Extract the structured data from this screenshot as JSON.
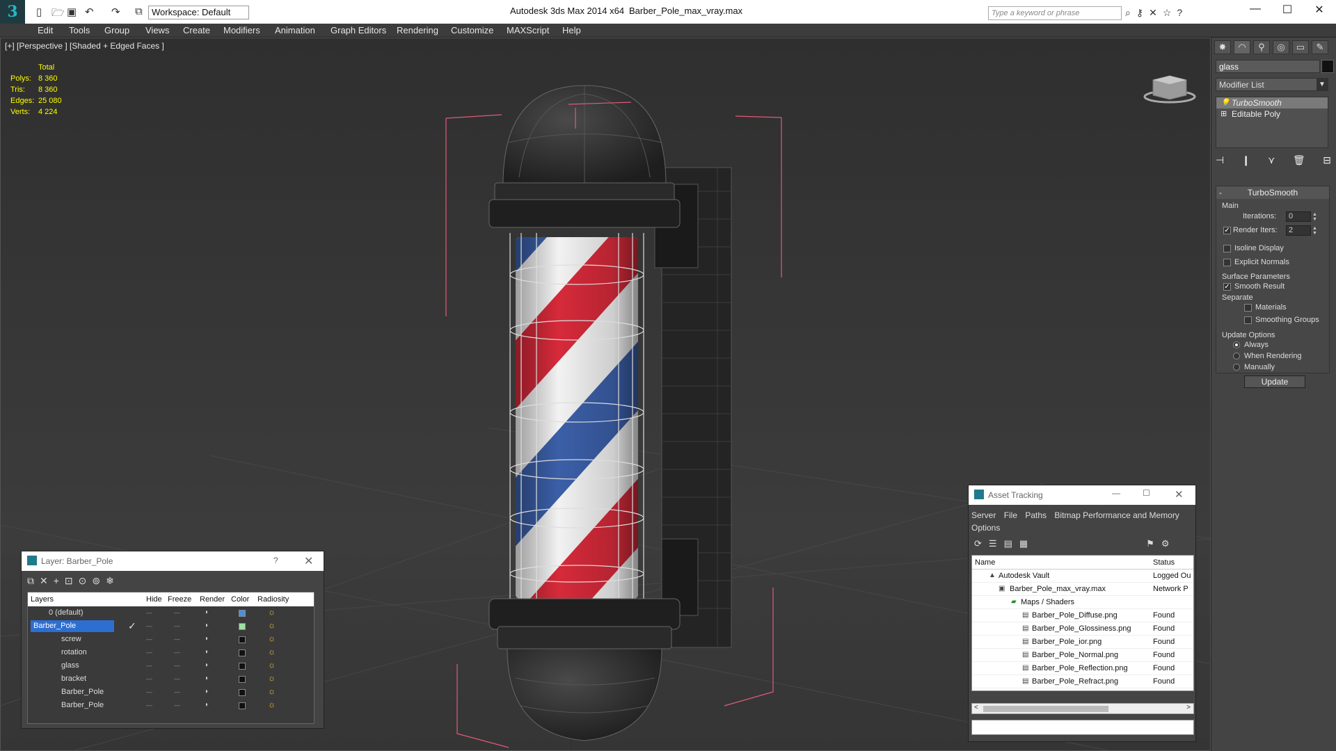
{
  "titlebar": {
    "app_title": "Autodesk 3ds Max  2014 x64",
    "file_name": "Barber_Pole_max_vray.max",
    "workspace": "Workspace: Default",
    "search_placeholder": "Type a keyword or phrase"
  },
  "menu": [
    "Edit",
    "Tools",
    "Group",
    "Views",
    "Create",
    "Modifiers",
    "Animation",
    "Graph Editors",
    "Rendering",
    "Customize",
    "MAXScript",
    "Help"
  ],
  "viewport": {
    "label": "[+] [Perspective ] [Shaded + Edged Faces ]",
    "stats": {
      "header": "Total",
      "rows": [
        {
          "k": "Polys:",
          "v": "8 360"
        },
        {
          "k": "Tris:",
          "v": "8 360"
        },
        {
          "k": "Edges:",
          "v": "25 080"
        },
        {
          "k": "Verts:",
          "v": "4 224"
        }
      ]
    },
    "stripe_colors": {
      "red": "#d62a3a",
      "blue": "#3b5fa8",
      "white": "#f2f2f2"
    }
  },
  "command_panel": {
    "object_name": "glass",
    "modifier_list": "Modifier List",
    "stack": [
      "TurboSmooth",
      "Editable Poly"
    ],
    "rollout_title": "TurboSmooth",
    "main_label": "Main",
    "iterations_label": "Iterations:",
    "iterations_value": "0",
    "render_iters_label": "Render Iters:",
    "render_iters_value": "2",
    "isoline": "Isoline Display",
    "explicit": "Explicit Normals",
    "surface_params": "Surface Parameters",
    "smooth_result": "Smooth Result",
    "separate": "Separate",
    "materials": "Materials",
    "smoothing_groups": "Smoothing Groups",
    "update_options": "Update Options",
    "always": "Always",
    "when_rendering": "When Rendering",
    "manually": "Manually",
    "update_btn": "Update"
  },
  "layer_panel": {
    "title": "Layer: Barber_Pole",
    "help": "?",
    "columns": [
      "Layers",
      "Hide",
      "Freeze",
      "Render",
      "Color",
      "Radiosity"
    ],
    "rows": [
      {
        "name": "0 (default)",
        "color": "#4a90d9"
      },
      {
        "name": "Barber_Pole",
        "color": "#9fe0a0"
      },
      {
        "name": "screw",
        "color": "#111111"
      },
      {
        "name": "rotation",
        "color": "#111111"
      },
      {
        "name": "glass",
        "color": "#111111"
      },
      {
        "name": "bracket",
        "color": "#111111"
      },
      {
        "name": "Barber_Pole",
        "color": "#111111"
      },
      {
        "name": "Barber_Pole",
        "color": "#111111"
      }
    ]
  },
  "asset_panel": {
    "title": "Asset Tracking",
    "menu": [
      "Server",
      "File",
      "Paths",
      "Bitmap Performance and Memory",
      "Options"
    ],
    "columns": [
      "Name",
      "Status"
    ],
    "rows": [
      {
        "name": "Autodesk Vault",
        "status": "Logged Ou"
      },
      {
        "name": "Barber_Pole_max_vray.max",
        "status": "Network P"
      },
      {
        "name": "Maps / Shaders",
        "status": ""
      },
      {
        "name": "Barber_Pole_Diffuse.png",
        "status": "Found"
      },
      {
        "name": "Barber_Pole_Glossiness.png",
        "status": "Found"
      },
      {
        "name": "Barber_Pole_ior.png",
        "status": "Found"
      },
      {
        "name": "Barber_Pole_Normal.png",
        "status": "Found"
      },
      {
        "name": "Barber_Pole_Reflection.png",
        "status": "Found"
      },
      {
        "name": "Barber_Pole_Refract.png",
        "status": "Found"
      }
    ]
  }
}
